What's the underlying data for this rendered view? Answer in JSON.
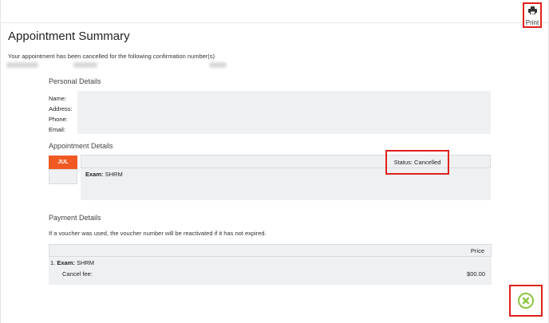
{
  "toolbar": {
    "print_label": "Print",
    "print_icon": "printer-icon"
  },
  "summary": {
    "title": "Appointment Summary",
    "cancel_message": "Your appointment has been cancelled for the following confirmation number(s)"
  },
  "personal": {
    "heading": "Personal Details",
    "labels": [
      "Name:",
      "Address:",
      "Phone:",
      "Email:"
    ]
  },
  "appointment": {
    "heading": "Appointment Details",
    "month": "JUL",
    "status": "Status: Cancelled",
    "exam_label": "Exam:",
    "exam_value": "SHRM"
  },
  "payment": {
    "heading": "Payment Details",
    "note": "If a voucher was used, the voucher number will be reactivated if it has not expired.",
    "price_header": "Price",
    "item_prefix": "1.",
    "item_label": "Exam:",
    "item_value": "SHRM",
    "cancel_fee_label": "Cancel fee:",
    "cancel_fee_amount": "$00.00"
  },
  "colors": {
    "accent_orange": "#f05a22",
    "highlight_red": "#e0201d",
    "close_green": "#8cc63f",
    "panel_bg": "#eef0f2"
  },
  "close_icon": "close-icon"
}
